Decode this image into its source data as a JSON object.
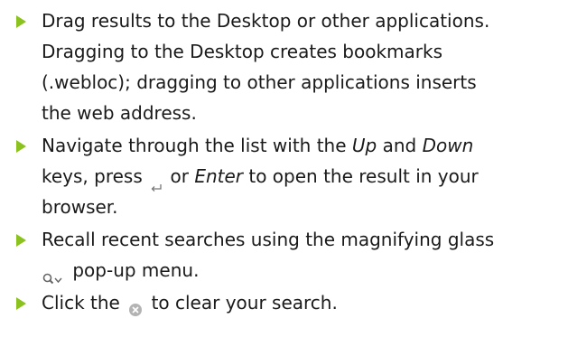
{
  "tips": [
    {
      "line1": "Drag results to the Desktop or other applications.",
      "line2": "Dragging to the Desktop creates bookmarks",
      "line3": "(.webloc); dragging to other applications inserts",
      "line4": "the web address."
    },
    {
      "a": "Navigate through the list with the",
      "up": "Up",
      "and": "and",
      "down": "Down",
      "b": "keys, press",
      "or": "or",
      "enter": "Enter",
      "c": "to open the result in your",
      "d": "browser."
    },
    {
      "a": "Recall recent searches using the magnifying glass",
      "b": "pop-up menu."
    },
    {
      "a": "Click the",
      "b": "to clear your search."
    }
  ],
  "icons": {
    "bullet": "disclosure-triangle-icon",
    "return": "return-key-icon",
    "search_menu": "magnifying-glass-menu-icon",
    "clear": "clear-search-icon"
  },
  "colors": {
    "bullet": "#8bc21f",
    "text": "#1a1a1a",
    "icon_gray": "#9a9a9a"
  }
}
